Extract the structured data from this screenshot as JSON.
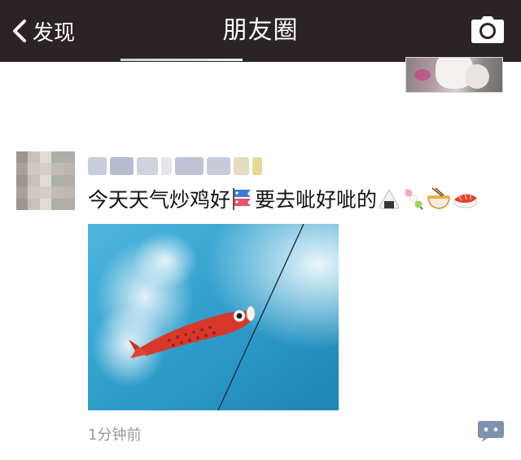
{
  "navbar": {
    "back_label": "发现",
    "title": "朋友圈",
    "background": "#2b2325"
  },
  "previous_post": {
    "thumbnail_icon": "photo-thumbnail"
  },
  "post": {
    "author_name_blurred": true,
    "text_part1": "今天天气炒鸡好",
    "text_part2": " 要去呲好呲的",
    "emojis": [
      "carp-streamer-emoji",
      "rice-ball-emoji",
      "dango-emoji",
      "ramen-emoji",
      "sushi-emoji"
    ],
    "image": {
      "description_icon": "koi-kite-photo",
      "sky_color": "#2b98c6"
    },
    "time": "1分钟前",
    "comment_icon": "comment-icon",
    "comment_color": "#7e92ae"
  }
}
